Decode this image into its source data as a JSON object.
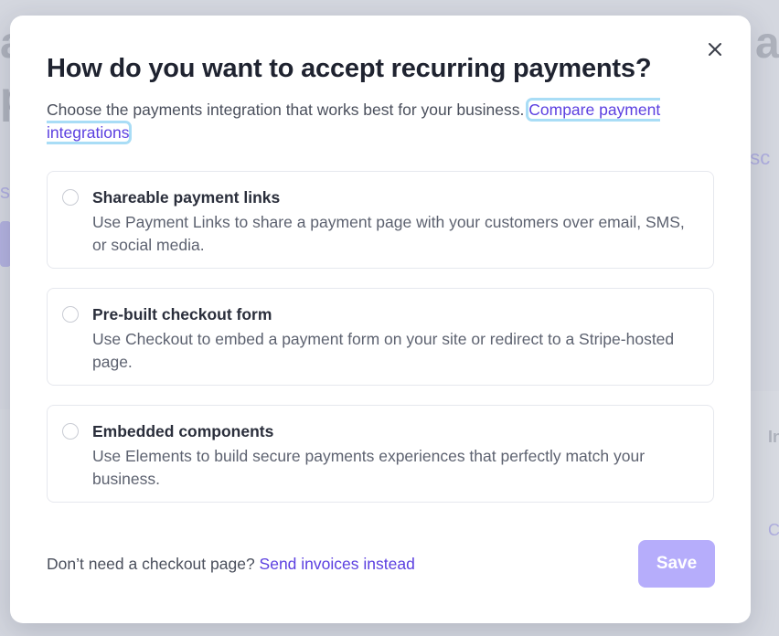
{
  "modal": {
    "title": "How do you want to accept recurring payments?",
    "description": "Choose the payments integration that works best for your business.",
    "compare_link": "Compare payment integrations",
    "close_label": "×",
    "options": [
      {
        "title": "Shareable payment links",
        "description": "Use Payment Links to share a payment page with your customers over email, SMS, or social media."
      },
      {
        "title": "Pre-built checkout form",
        "description": "Use Checkout to embed a payment form on your site or redirect to a Stripe-hosted page."
      },
      {
        "title": "Embedded components",
        "description": "Use Elements to build secure payments experiences that perfectly match your business."
      }
    ],
    "footer_question": "Don’t need a checkout page?",
    "footer_link": "Send invoices instead",
    "save_label": "Save"
  },
  "colors": {
    "accent": "#5b3fe0",
    "save_disabled": "#b6adfb",
    "focus_ring": "#a9ddf6"
  }
}
